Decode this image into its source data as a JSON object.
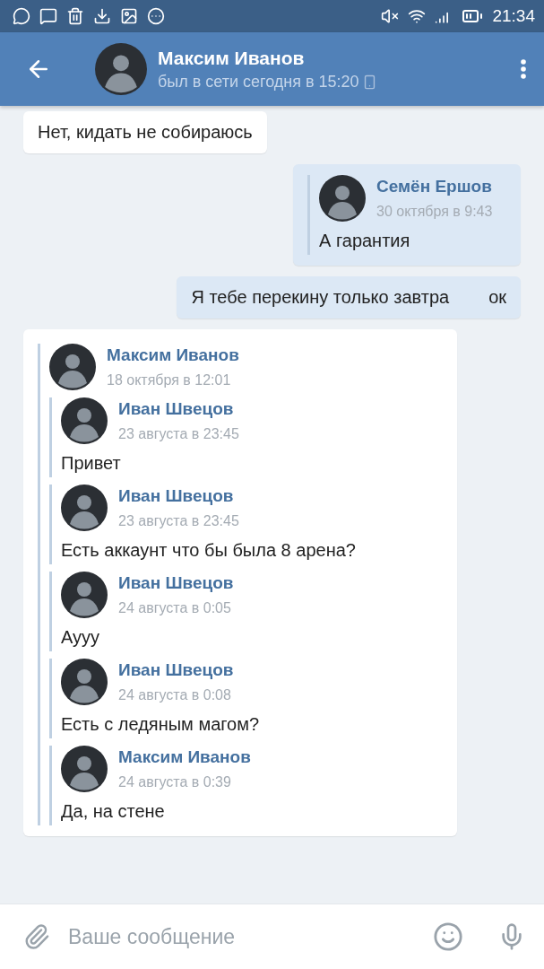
{
  "status_bar": {
    "time": "21:34"
  },
  "header": {
    "name": "Максим Иванов",
    "status": "был в сети сегодня в 15:20"
  },
  "messages": [
    {
      "kind": "text",
      "outgoing": false,
      "parts": [
        "Нет, кидать не собираюсь"
      ]
    },
    {
      "kind": "forward",
      "outgoing": true,
      "quotes": [
        {
          "name": "Семён Ершов",
          "date": "30 октября в 9:43",
          "text": "А гарантия"
        }
      ]
    },
    {
      "kind": "text",
      "outgoing": true,
      "parts": [
        "Я тебе перекину только завтра",
        "ок"
      ]
    },
    {
      "kind": "forward",
      "outgoing": false,
      "quotes": [
        {
          "name": "Максим Иванов",
          "date": "18 октября в 12:01",
          "children": [
            {
              "name": "Иван Швецов",
              "date": "23 августа в 23:45",
              "text": "Привет"
            },
            {
              "name": "Иван Швецов",
              "date": "23 августа в 23:45",
              "text": "Есть аккаунт что бы была 8 арена?"
            },
            {
              "name": "Иван Швецов",
              "date": "24 августа в 0:05",
              "text": "Аууу"
            },
            {
              "name": "Иван Швецов",
              "date": "24 августа в 0:08",
              "text": "Есть с ледяным магом?"
            },
            {
              "name": "Максим Иванов",
              "date": "24 августа в 0:39",
              "text": "Да, на стене"
            }
          ]
        }
      ]
    }
  ],
  "composer": {
    "placeholder": "Ваше сообщение"
  }
}
